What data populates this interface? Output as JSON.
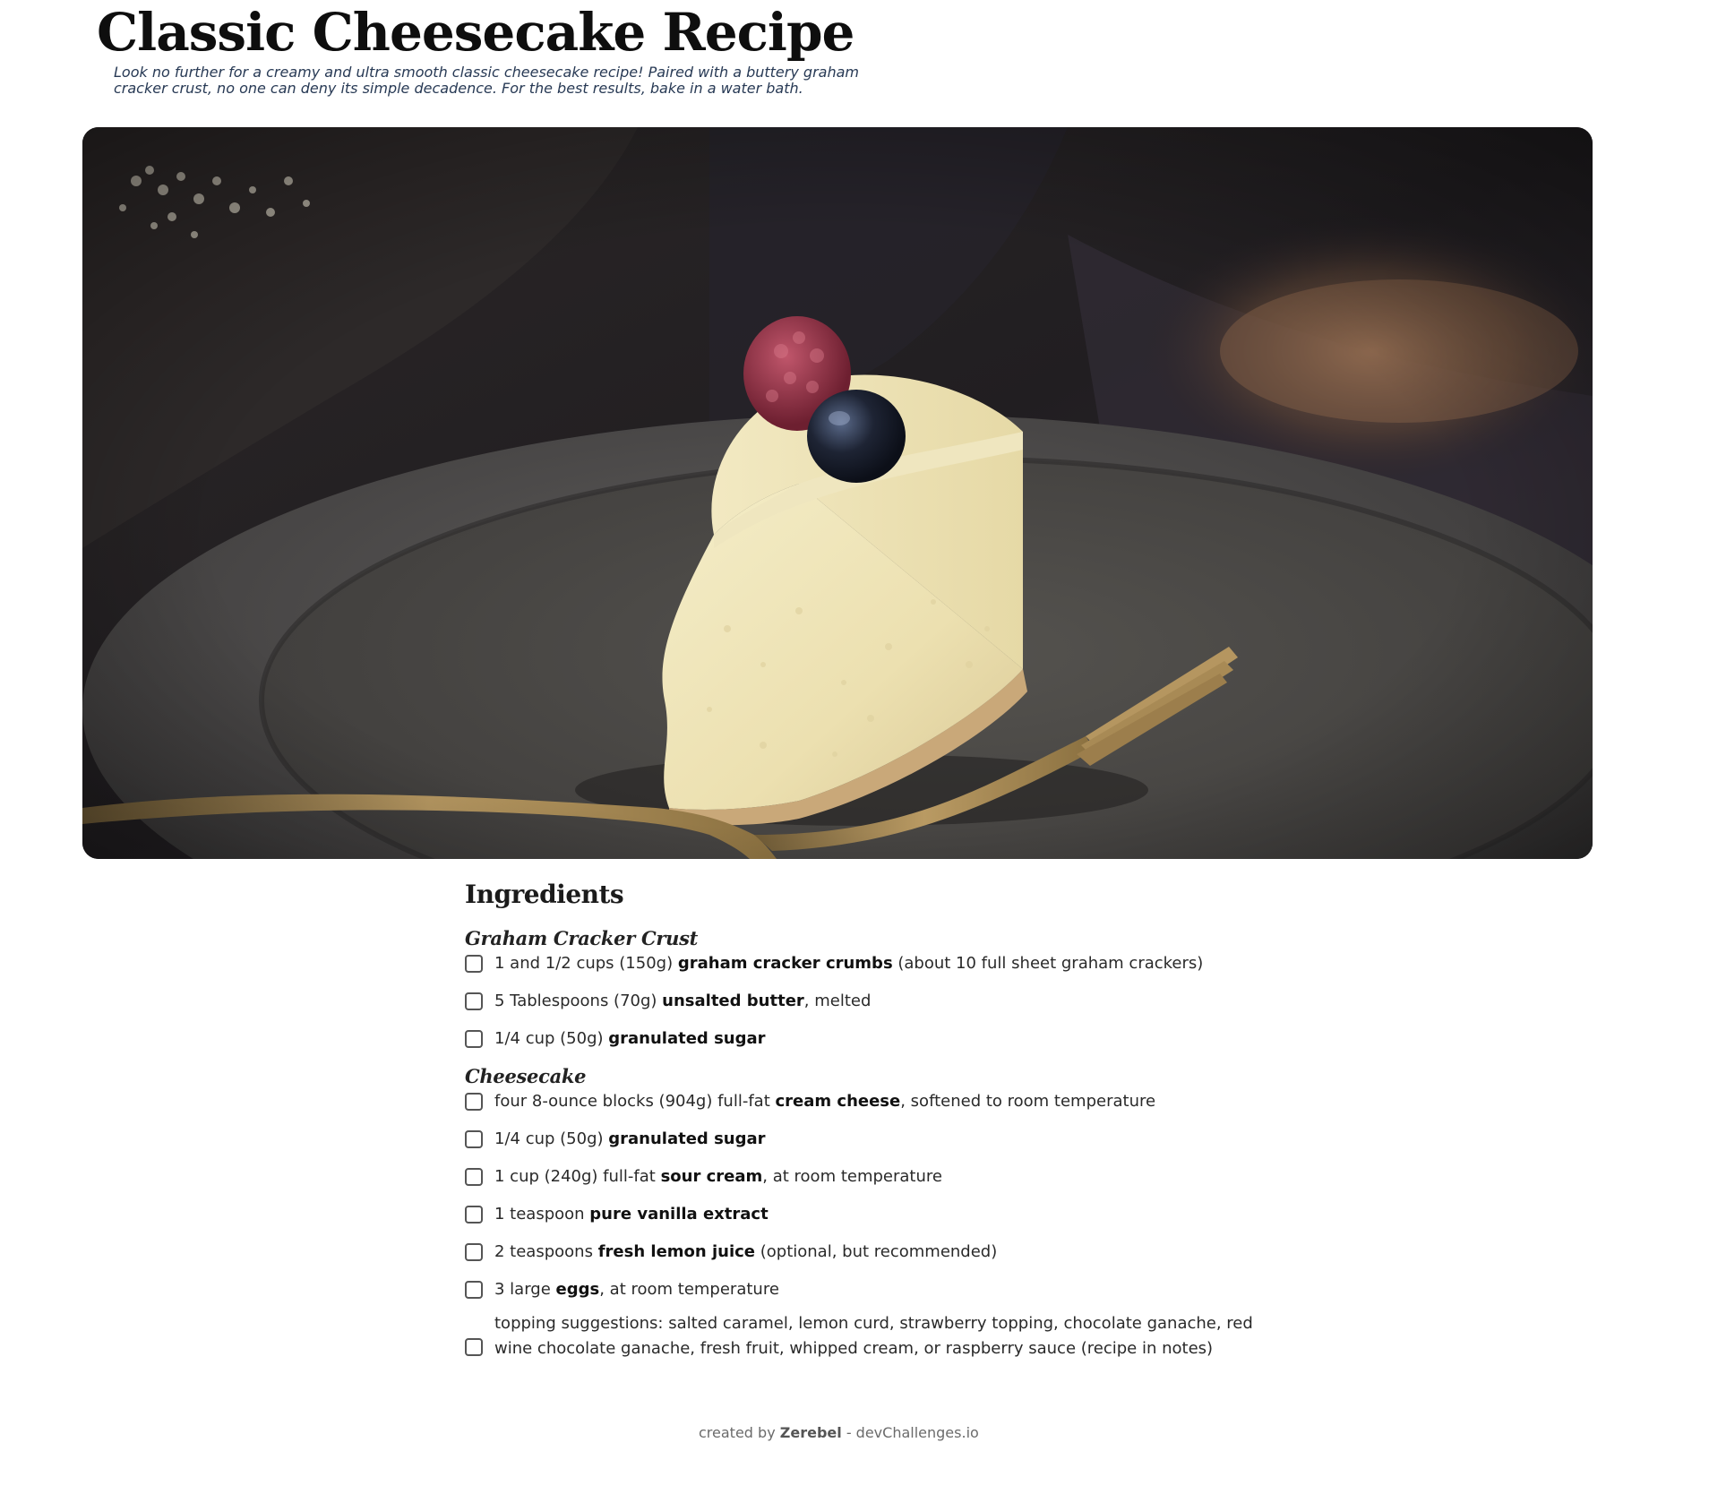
{
  "recipe": {
    "title": "Classic Cheesecake Recipe",
    "description": "Look no further for a creamy and ultra smooth classic cheesecake recipe! Paired with a buttery graham cracker crust, no one can deny its simple decadence. For the best results, bake in a water bath."
  },
  "ingredients": {
    "heading": "Ingredients",
    "sections": [
      {
        "title": "Graham Cracker Crust",
        "items": [
          {
            "pre": "1 and 1/2 cups (150g) ",
            "bold": "graham cracker crumbs",
            "post": " (about 10 full sheet graham crackers)"
          },
          {
            "pre": "5 Tablespoons (70g) ",
            "bold": "unsalted butter",
            "post": ", melted"
          },
          {
            "pre": "1/4 cup (50g) ",
            "bold": "granulated sugar",
            "post": ""
          }
        ]
      },
      {
        "title": "Cheesecake",
        "items": [
          {
            "pre": "four 8-ounce blocks (904g) full-fat ",
            "bold": "cream cheese",
            "post": ", softened to room temperature"
          },
          {
            "pre": "1/4 cup (50g) ",
            "bold": "granulated sugar",
            "post": ""
          },
          {
            "pre": "1 cup (240g) full-fat ",
            "bold": "sour cream",
            "post": ", at room temperature"
          },
          {
            "pre": "1 teaspoon ",
            "bold": "pure vanilla extract",
            "post": ""
          },
          {
            "pre": "2 teaspoons ",
            "bold": "fresh lemon juice",
            "post": " (optional, but recommended)"
          },
          {
            "pre": "3 large ",
            "bold": "eggs",
            "post": ", at room temperature"
          },
          {
            "pre": "topping suggestions: salted caramel, lemon curd, strawberry topping, chocolate ganache, red wine chocolate ganache, fresh fruit, whipped cream, or raspberry sauce (recipe in notes)",
            "bold": "",
            "post": ""
          }
        ]
      }
    ]
  },
  "footer": {
    "prefix": "created by ",
    "author": "Zerebel",
    "suffix": " - devChallenges.io"
  },
  "colors": {
    "title": "#0e0e0e",
    "description": "#283a55",
    "footer": "#6b6b6b"
  }
}
